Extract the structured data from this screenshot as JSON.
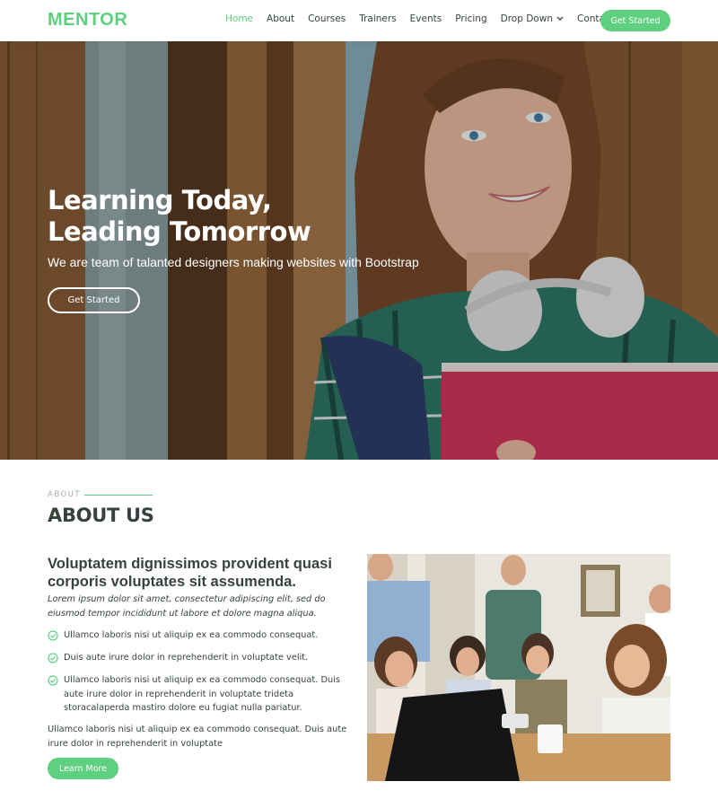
{
  "brand": {
    "logo": "MENTOR"
  },
  "nav": {
    "items": [
      "Home",
      "About",
      "Courses",
      "Trainers",
      "Events",
      "Pricing",
      "Drop Down",
      "Contact"
    ],
    "cta": "Get Started"
  },
  "hero": {
    "title_line1": "Learning Today,",
    "title_line2": "Leading Tomorrow",
    "subtitle": "We are team of talanted designers making websites with Bootstrap",
    "button": "Get Started"
  },
  "about": {
    "label": "ABOUT",
    "title": "ABOUT US",
    "heading": "Voluptatem dignissimos provident quasi corporis voluptates sit assumenda.",
    "italic": "Lorem ipsum dolor sit amet, consectetur adipiscing elit, sed do eiusmod tempor incididunt ut labore et dolore magna aliqua.",
    "checks": [
      "Ullamco laboris nisi ut aliquip ex ea commodo consequat.",
      "Duis aute irure dolor in reprehenderit in voluptate velit.",
      "Ullamco laboris nisi ut aliquip ex ea commodo consequat. Duis aute irure dolor in reprehenderit in voluptate trideta storacalaperda mastiro dolore eu fugiat nulla pariatur."
    ],
    "paragraph": "Ullamco laboris nisi ut aliquip ex ea commodo consequat. Duis aute irure dolor in reprehenderit in voluptate",
    "button": "Learn More"
  },
  "colors": {
    "accent": "#5fcf80",
    "text": "#37423b"
  }
}
